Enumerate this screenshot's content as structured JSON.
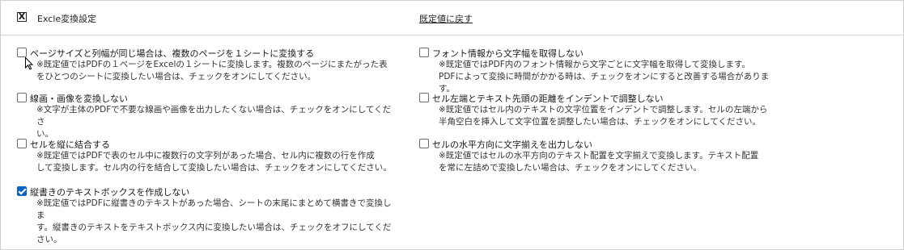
{
  "header": {
    "close_glyph": "X",
    "title": "Excle変換設定",
    "reset_link": "既定値に戻す"
  },
  "left_options": [
    {
      "label": "ページサイズと列幅が同じ場合は、複数のページを１シートに変換する",
      "description": "※既定値ではPDFの１ページをExcelの１シートに変換します。複数のページにまたがった表\nをひとつのシートに変換したい場合は、チェックをオンにしてください。",
      "checked": false
    },
    {
      "label": "線画・画像を変換しない",
      "description": "※文字が主体のPDFで不要な線画や画像を出力したくない場合は、チェックをオンにしてくださ\nい。",
      "checked": false
    },
    {
      "label": "セルを縦に結合する",
      "description": "※既定値ではPDFで表のセル中に複数行の文字列があった場合、セル内に複数の行を作成\nして変換します。セル内の行を結合して変換したい場合は、チェックをオンにしてください。",
      "checked": false
    },
    {
      "label": "縦書きのテキストボックスを作成しない",
      "description": "※既定値ではPDFに縦書きのテキストがあった場合、シートの末尾にまとめて横書きで変換しま\nす。縦書きのテキストをテキストボックス内に変換したい場合は、チェックをオフにしてください。",
      "checked": true
    }
  ],
  "right_options": [
    {
      "label": "フォント情報から文字幅を取得しない",
      "description": "※既定値ではPDF内のフォント情報から文字ごとに文字幅を取得して変換します。\nPDFによって変換に時間がかかる時は、チェックをオンにすると改善する場合があります。",
      "checked": false
    },
    {
      "label": "セル左端とテキスト先頭の距離をインデントで調整しない",
      "description": "※既定値ではセル内のテキストの文字位置をインデントで調整します。セルの左端から\n半角空白を挿入して文字位置を調整したい場合は、チェックをオンにしてください。",
      "checked": false
    },
    {
      "label": "セルの水平方向に文字揃えを出力しない",
      "description": "※既定値ではセルの水平方向のテキスト配置を文字揃えで変換します。テキスト配置\nを常に左詰めで変換したい場合は、チェックをオンにしてください。",
      "checked": false
    }
  ],
  "colors": {
    "checked_fill": "#0a64c8",
    "border": "#cfcfcf"
  }
}
